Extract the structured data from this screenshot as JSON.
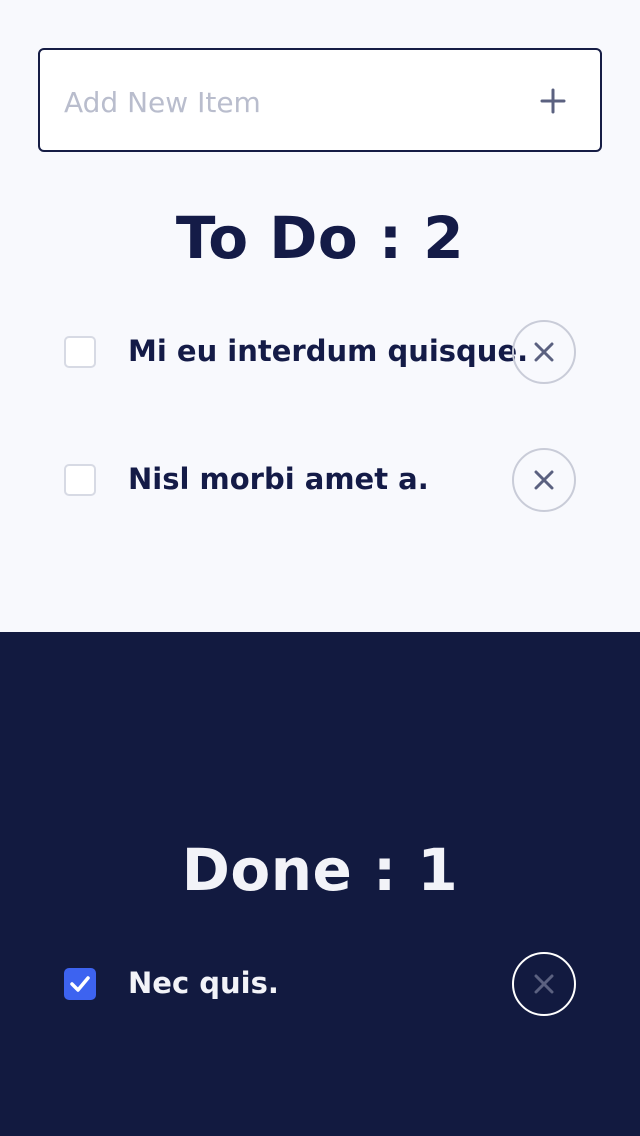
{
  "add_form": {
    "placeholder": "Add New Item",
    "value": "",
    "add_icon": "plus-icon"
  },
  "todo": {
    "title": "To Do : 2",
    "items": [
      {
        "label": "Mi eu interdum quisque.",
        "checked": false
      },
      {
        "label": "Nisl morbi amet a.",
        "checked": false
      }
    ]
  },
  "done": {
    "title": "Done : 1",
    "items": [
      {
        "label": "Nec quis.",
        "checked": true
      }
    ]
  },
  "colors": {
    "navy": "#121a40",
    "light_bg": "#f8f9fd",
    "accent": "#3d63f0"
  }
}
